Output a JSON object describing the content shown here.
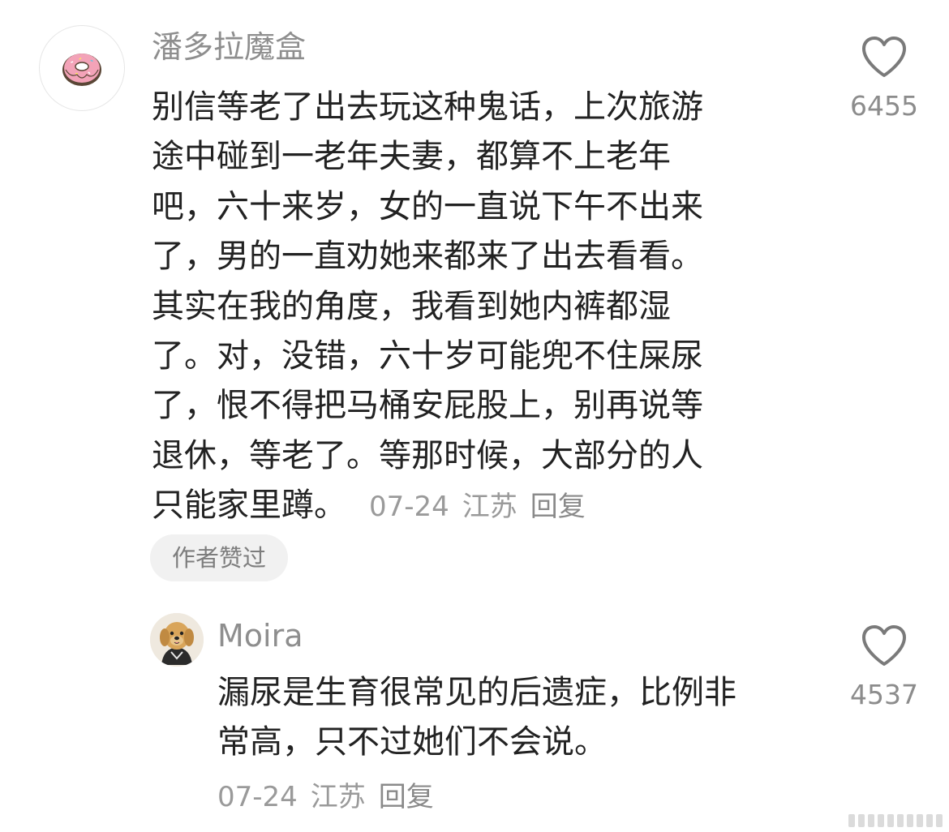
{
  "comment": {
    "username": "潘多拉魔盒",
    "avatar_icon": "donut-icon",
    "text_lines": [
      "别信等老了出去玩这种鬼话，上次旅游",
      "途中碰到一老年夫妻，都算不上老年",
      "吧，六十来岁，女的一直说下午不出来",
      "了，男的一直劝她来都来了出去看看。",
      "其实在我的角度，我看到她内裤都湿",
      "了。对，没错，六十岁可能兜不住屎尿",
      "了，恨不得把马桶安屁股上，别再说等",
      "退休，等老了。等那时候，大部分的人",
      "只能家里蹲。"
    ],
    "date": "07-24",
    "location": "江苏",
    "reply_label": "回复",
    "author_badge": "作者赞过",
    "like_icon": "heart-outline-icon",
    "like_count": "6455"
  },
  "reply": {
    "username": "Moira",
    "avatar_icon": "dog-avatar-icon",
    "text_lines": [
      "漏尿是生育很常见的后遗症，比例非",
      "常高，只不过她们不会说。"
    ],
    "date": "07-24",
    "location": "江苏",
    "reply_label": "回复",
    "like_icon": "heart-outline-icon",
    "like_count": "4537"
  },
  "colors": {
    "background": "#ffffff",
    "text": "#222222",
    "username": "#8e8e8e",
    "meta": "#9a9a9a",
    "badge_bg": "#f1f1f1",
    "donut_frosting": "#f3a3b8",
    "dog_fur": "#d9a55a"
  }
}
